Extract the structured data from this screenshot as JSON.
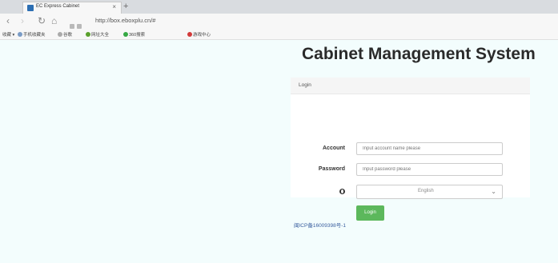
{
  "browser": {
    "tab_title": "EC Express Cabinet",
    "tab_close": "×",
    "new_tab": "+",
    "url": "http://box.eboxplu.cn/#",
    "nav": {
      "back": "‹",
      "forward": "›",
      "refresh": "↻",
      "home": "⌂"
    },
    "bookmarks": [
      "收藏",
      "手机收藏夹",
      "谷歌",
      "网址大全",
      "360搜索",
      "游戏中心"
    ]
  },
  "page": {
    "title": "Cabinet Management System",
    "panel_header": "Login",
    "account_label": "Account",
    "account_placeholder": "Input account name please",
    "password_label": "Password",
    "password_placeholder": "Input password please",
    "language_value": "English",
    "login_button": "Login",
    "footer_link": "闽ICP备16009398号-1"
  },
  "colors": {
    "accent_green": "#5cb85c",
    "page_bg": "#f3fdfd",
    "link": "#3a5f9f"
  }
}
